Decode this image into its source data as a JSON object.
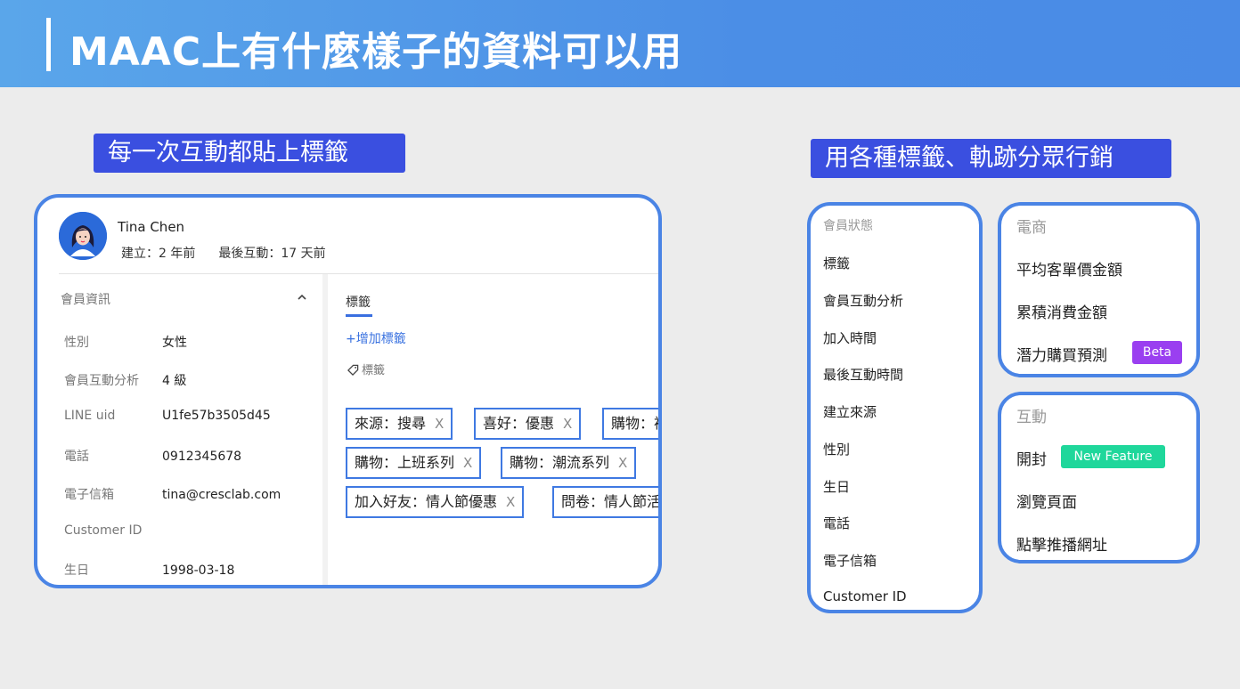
{
  "header": {
    "title": "MAAC上有什麼樣子的資料可以用"
  },
  "left_label": "每一次互動都貼上標籤",
  "right_label": "用各種標籤、軌跡分眾行銷",
  "profile": {
    "name": "Tina Chen",
    "created": "建立：2 年前",
    "last_interaction": "最後互動：17 天前",
    "info_title": "會員資訊",
    "fields": [
      {
        "key": "性別",
        "value": "女性"
      },
      {
        "key": "會員互動分析",
        "value": "4 級"
      },
      {
        "key": "LINE uid",
        "value": "U1fe57b3505d45"
      },
      {
        "key": "電話",
        "value": "0912345678"
      },
      {
        "key": "電子信箱",
        "value": "tina@cresclab.com"
      },
      {
        "key": "Customer ID",
        "value": ""
      },
      {
        "key": "生日",
        "value": "1998-03-18"
      }
    ],
    "tab_label": "標籤",
    "add_tag": "+增加標籤",
    "tag_header": "標籤",
    "tags": [
      "來源：搜尋",
      "喜好：優惠",
      "購物：裙裝",
      "購物：上班系列",
      "購物：潮流系列",
      "加入好友：情人節優惠",
      "問卷：情人節活動問卷"
    ],
    "tag_remove": "X"
  },
  "member_panel": {
    "title": "會員狀態",
    "items": [
      "標籤",
      "會員互動分析",
      "加入時間",
      "最後互動時間",
      "建立來源",
      "性別",
      "生日",
      "電話",
      "電子信箱",
      "Customer ID"
    ]
  },
  "ecommerce_panel": {
    "title": "電商",
    "items": [
      "平均客單價金額",
      "累積消費金額",
      "潛力購買預測"
    ],
    "beta_badge": "Beta"
  },
  "interaction_panel": {
    "title": "互動",
    "items": [
      "開封",
      "瀏覽頁面",
      "點擊推播網址"
    ],
    "new_badge": "New Feature"
  },
  "colors": {
    "header": "#4b8ee6",
    "label_bg": "#3a4fe0",
    "card_border": "#4a84e5",
    "beta": "#9a3ff0",
    "new_feature": "#1fd79b"
  }
}
